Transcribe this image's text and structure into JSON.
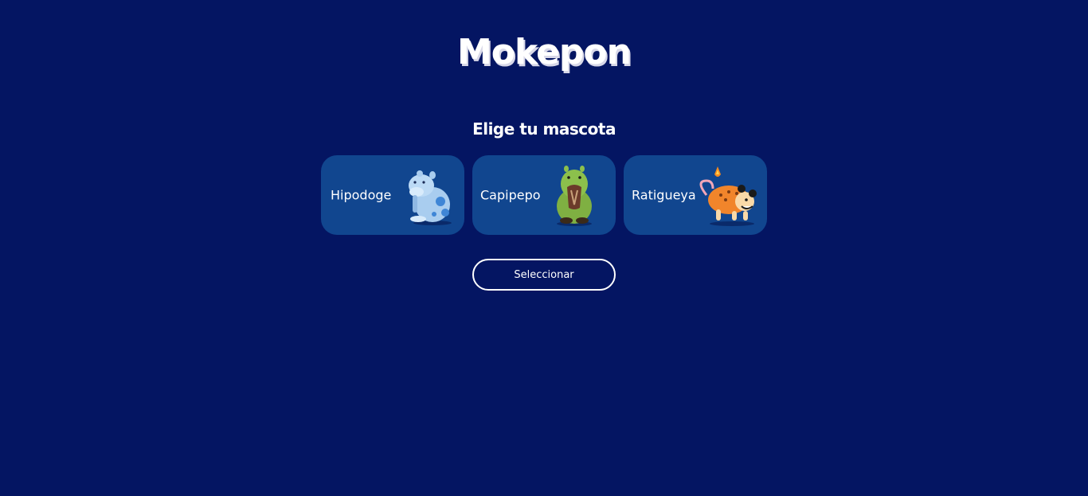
{
  "app": {
    "title": "Mokepon"
  },
  "select_section": {
    "heading": "Elige tu mascota",
    "pets": [
      {
        "name": "Hipodoge",
        "icon": "hipodoge-pet-icon"
      },
      {
        "name": "Capipepo",
        "icon": "capipepo-pet-icon"
      },
      {
        "name": "Ratigueya",
        "icon": "ratigueya-pet-icon"
      }
    ],
    "select_button_label": "Seleccionar"
  },
  "colors": {
    "background": "#041562",
    "card": "#11468f",
    "text": "#ffffff"
  }
}
